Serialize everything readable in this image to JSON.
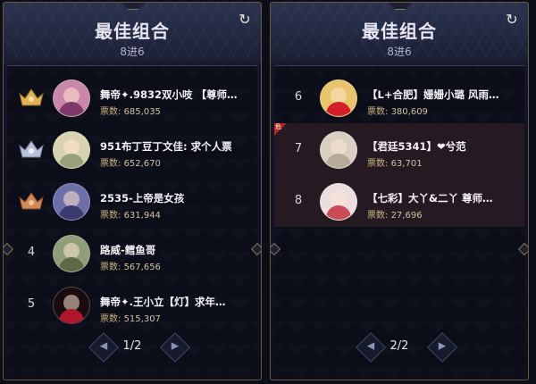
{
  "panels": [
    {
      "title": "最佳组合",
      "subtitle": "8进6",
      "page": "1/2",
      "items": [
        {
          "rank": "1",
          "crown": "gold",
          "name": "舞帝✦.9832双小吱 【尊师…",
          "votes_label": "票数:",
          "votes": "685,035",
          "avatar_color": "#c987a9"
        },
        {
          "rank": "2",
          "crown": "silver",
          "name": "951布丁豆丁文佳: 求个人票",
          "votes_label": "票数:",
          "votes": "652,670",
          "avatar_color": "#d9d2b0"
        },
        {
          "rank": "3",
          "crown": "bronze",
          "name": "2535-上帝是女孩",
          "votes_label": "票数:",
          "votes": "631,944",
          "avatar_color": "#6d6fa8"
        },
        {
          "rank": "4",
          "crown": "",
          "name": "路威-鳕鱼哥",
          "votes_label": "票数:",
          "votes": "567,656",
          "avatar_color": "#8e9d7a"
        },
        {
          "rank": "5",
          "crown": "",
          "name": "舞帝✦.王小立【灯】求年…",
          "votes_label": "票数:",
          "votes": "515,307",
          "avatar_color": "#b2162a"
        }
      ]
    },
    {
      "title": "最佳组合",
      "subtitle": "8进6",
      "page": "2/2",
      "items": [
        {
          "rank": "6",
          "crown": "",
          "name": "【L+合肥】姗姗小璐 风雨…",
          "votes_label": "票数:",
          "votes": "380,609",
          "avatar_color": "#d21f2a",
          "highlight": false
        },
        {
          "rank": "7",
          "crown": "",
          "name": "【君廷5341】❤兮范",
          "votes_label": "票数:",
          "votes": "63,701",
          "avatar_color": "#d8cfc2",
          "highlight": true,
          "flag": "危"
        },
        {
          "rank": "8",
          "crown": "",
          "name": "【七彩】大丫&二丫 尊师…",
          "votes_label": "票数:",
          "votes": "27,696",
          "avatar_color": "#c94b55",
          "highlight": true
        }
      ]
    }
  ],
  "icons": {
    "refresh": "refresh-icon",
    "prev": "prev-page-icon",
    "next": "next-page-icon",
    "crown": "crown-icon"
  },
  "colors": {
    "gold": "#e0b157",
    "silver": "#b9c2d8",
    "bronze": "#d08a56",
    "frame": "#6b5a3e"
  }
}
